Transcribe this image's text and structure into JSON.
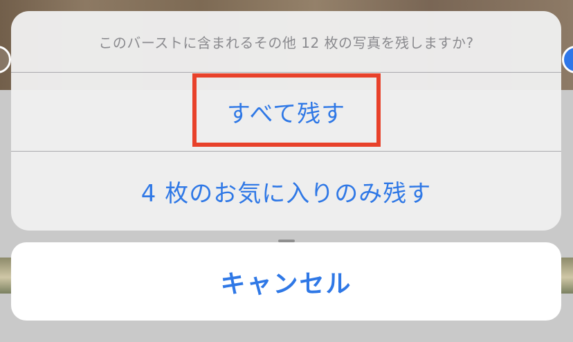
{
  "action_sheet": {
    "message": "このバーストに含まれるその他 12 枚の写真を残しますか?",
    "keep_all_label": "すべて残す",
    "keep_favorites_label": "4 枚のお気に入りのみ残す",
    "cancel_label": "キャンセル"
  },
  "colors": {
    "action_blue": "#2f78e6",
    "highlight_red": "#e8412a",
    "message_gray": "#8a8a8e"
  }
}
